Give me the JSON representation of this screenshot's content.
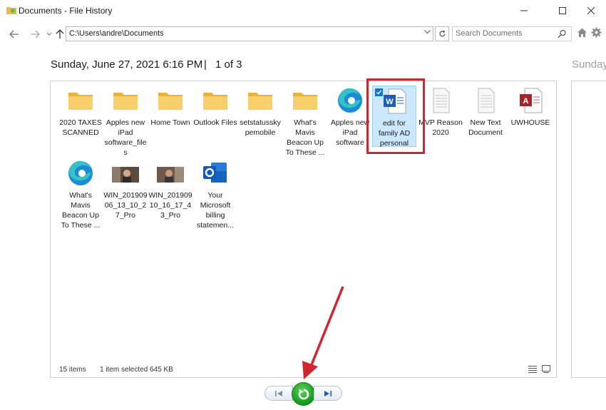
{
  "window": {
    "title": "Documents - File History"
  },
  "address": {
    "path": "C:\\Users\\andre\\Documents"
  },
  "search": {
    "placeholder": "Search Documents"
  },
  "snapshot": {
    "date": "Sunday, June 27, 2021 6:16 PM",
    "separator": "|",
    "count": "1 of 3",
    "next_label": "Sunday"
  },
  "files": [
    {
      "name": "2020 TAXES SCANNED",
      "icon": "folder-icon"
    },
    {
      "name": "Apples new iPad software_files",
      "icon": "folder-icon"
    },
    {
      "name": "Home Town",
      "icon": "folder-icon"
    },
    {
      "name": "Outlook Files",
      "icon": "folder-icon"
    },
    {
      "name": "setstatusskypemobile",
      "icon": "folder-icon"
    },
    {
      "name": "What's Mavis Beacon Up To These ...",
      "icon": "folder-icon"
    },
    {
      "name": "Apples new iPad software",
      "icon": "edge-icon"
    },
    {
      "name": "edit for family AD personal",
      "icon": "word-doc-icon",
      "selected": true
    },
    {
      "name": "MVP Reason 2020",
      "icon": "text-file-icon"
    },
    {
      "name": "New Text Document",
      "icon": "text-file-icon"
    },
    {
      "name": "UWHOUSE",
      "icon": "access-db-icon"
    },
    {
      "name": "What's Mavis Beacon Up To These ...",
      "icon": "edge-icon"
    },
    {
      "name": "WIN_20190906_13_10_27_Pro",
      "icon": "photo-thumbnail-icon"
    },
    {
      "name": "WIN_20190910_16_17_43_Pro",
      "icon": "photo-thumbnail-icon"
    },
    {
      "name": "Your Microsoft billing statemen...",
      "icon": "outlook-icon"
    }
  ],
  "status": {
    "items": "15 items",
    "selected": "1 item selected",
    "size": "645 KB"
  },
  "colors": {
    "annotation": "#d1262e",
    "restore": "#119a19",
    "selection": "#cce8ff"
  }
}
